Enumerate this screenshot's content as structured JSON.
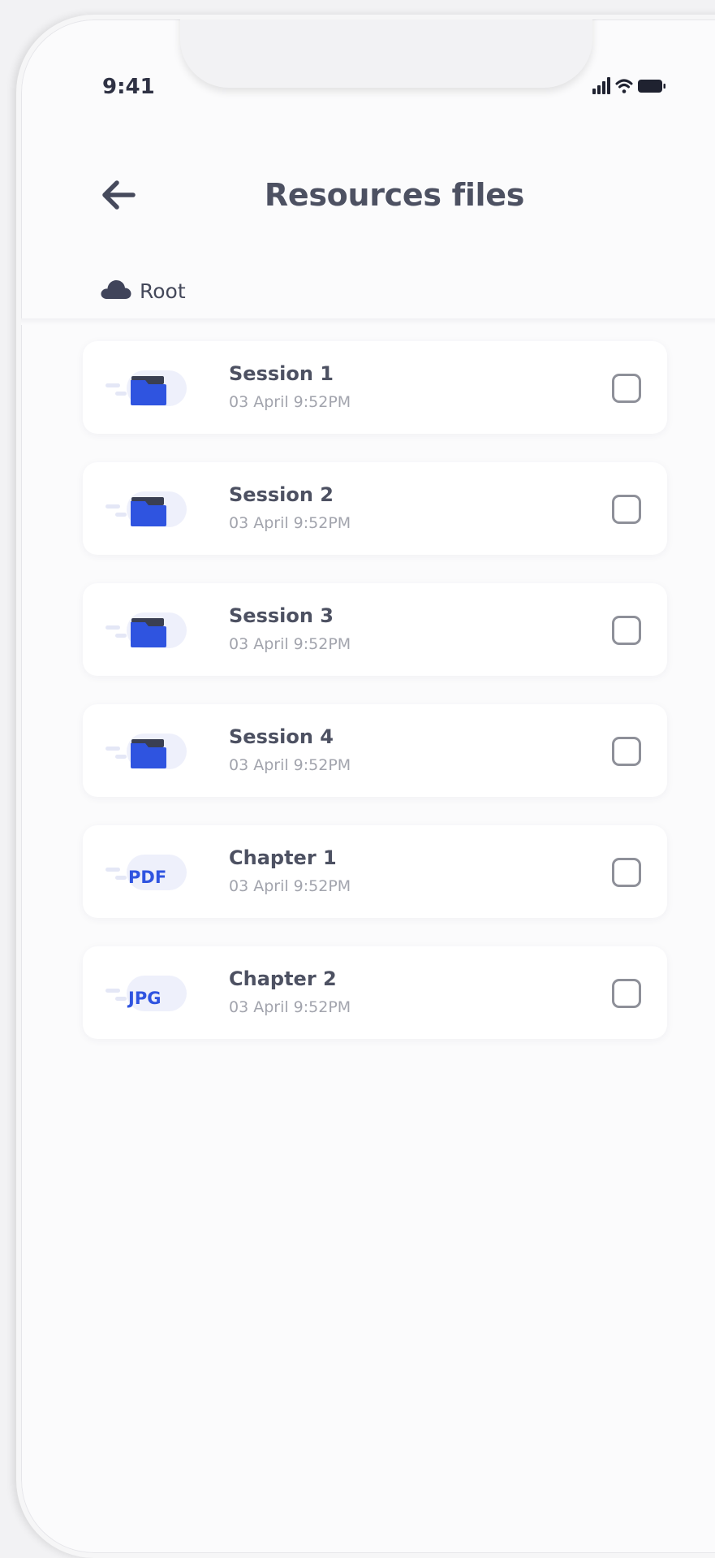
{
  "status_bar": {
    "time": "9:41",
    "icons": [
      "cellular-signal-icon",
      "wifi-icon",
      "battery-icon"
    ]
  },
  "header": {
    "back_icon": "arrow-left-icon",
    "title": "Resources files"
  },
  "breadcrumb": {
    "icon": "cloud-icon",
    "label": "Root"
  },
  "files": [
    {
      "name": "Session 1",
      "date": "03 April 9:52PM",
      "type": "folder",
      "checked": false
    },
    {
      "name": "Session 2",
      "date": "03 April 9:52PM",
      "type": "folder",
      "checked": false
    },
    {
      "name": "Session 3",
      "date": "03 April 9:52PM",
      "type": "folder",
      "checked": false
    },
    {
      "name": "Session 4",
      "date": "03 April 9:52PM",
      "type": "folder",
      "checked": false
    },
    {
      "name": "Chapter 1",
      "date": "03 April 9:52PM",
      "type": "file",
      "badge": "PDF",
      "checked": false
    },
    {
      "name": "Chapter 2",
      "date": "03 April 9:52PM",
      "type": "file",
      "badge": "JPG",
      "checked": false
    }
  ],
  "colors": {
    "accent": "#2f54e0",
    "text_primary": "#4d5162",
    "text_secondary": "#a2a4ad",
    "background": "#fbfbfc"
  }
}
